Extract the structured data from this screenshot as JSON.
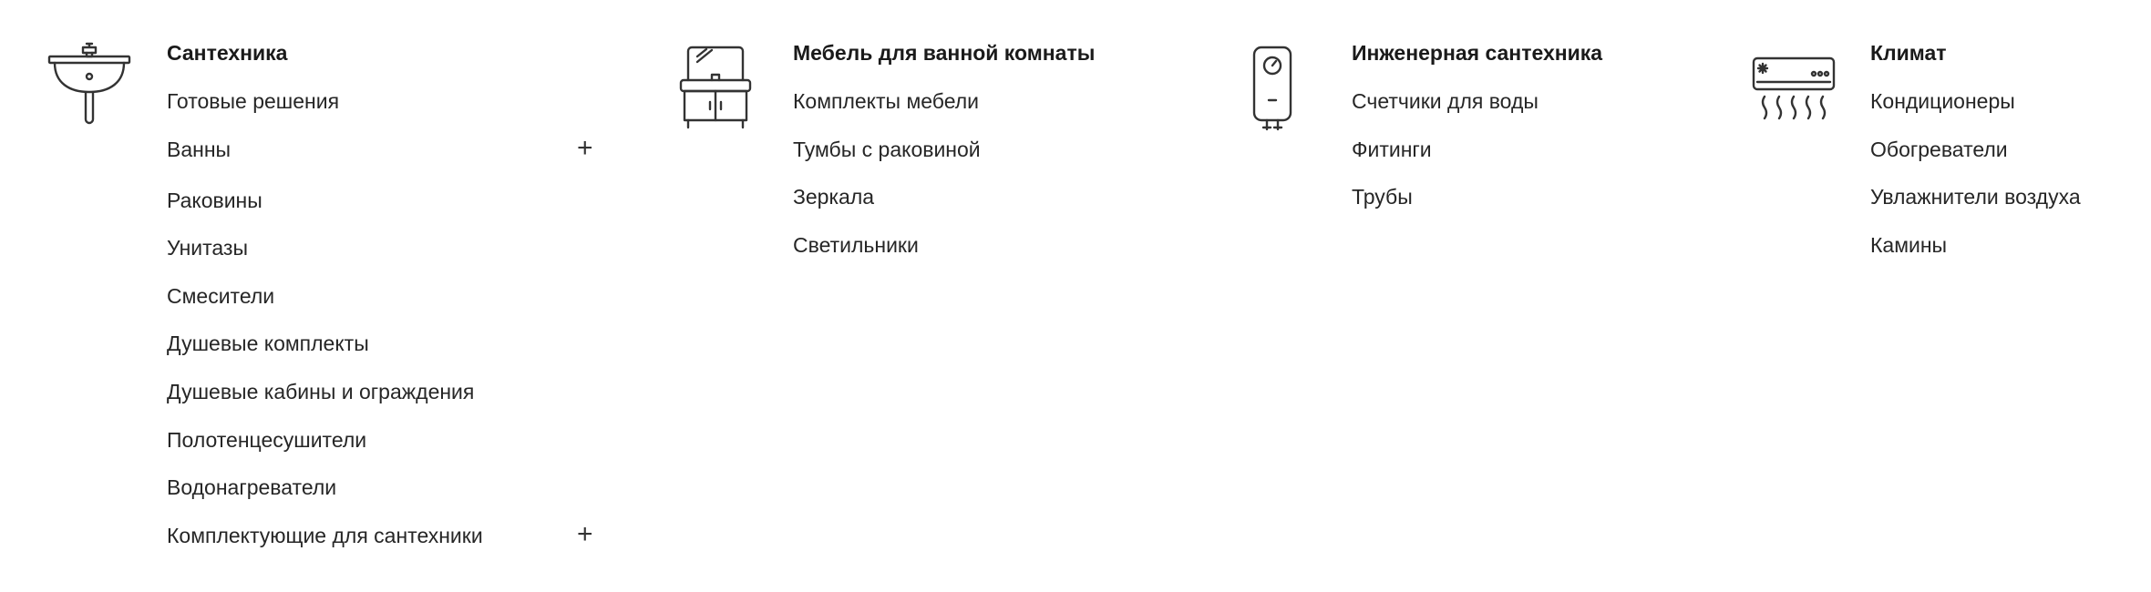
{
  "columns": [
    {
      "icon": "sink-icon",
      "title": "Сантехника",
      "items": [
        {
          "label": "Готовые решения"
        },
        {
          "label": "Ванны",
          "expand": "+"
        },
        {
          "label": "Раковины"
        },
        {
          "label": "Унитазы"
        },
        {
          "label": "Смесители"
        },
        {
          "label": "Душевые комплекты"
        },
        {
          "label": "Душевые кабины и ограждения"
        },
        {
          "label": "Полотенцесушители"
        },
        {
          "label": "Водонагреватели"
        },
        {
          "label": "Комплектующие для сантехники",
          "expand": "+"
        }
      ]
    },
    {
      "icon": "bathroom-vanity-icon",
      "title": "Мебель для ванной комнаты",
      "items": [
        {
          "label": "Комплекты мебели"
        },
        {
          "label": "Тумбы с раковиной"
        },
        {
          "label": "Зеркала"
        },
        {
          "label": "Светильники"
        }
      ]
    },
    {
      "icon": "water-heater-icon",
      "title": "Инженерная сантехника",
      "items": [
        {
          "label": "Счетчики для воды"
        },
        {
          "label": "Фитинги"
        },
        {
          "label": "Трубы"
        }
      ]
    },
    {
      "icon": "air-conditioner-icon",
      "title": "Климат",
      "items": [
        {
          "label": "Кондиционеры"
        },
        {
          "label": "Обогреватели"
        },
        {
          "label": "Увлажнители воздуха"
        },
        {
          "label": "Камины"
        }
      ]
    }
  ]
}
